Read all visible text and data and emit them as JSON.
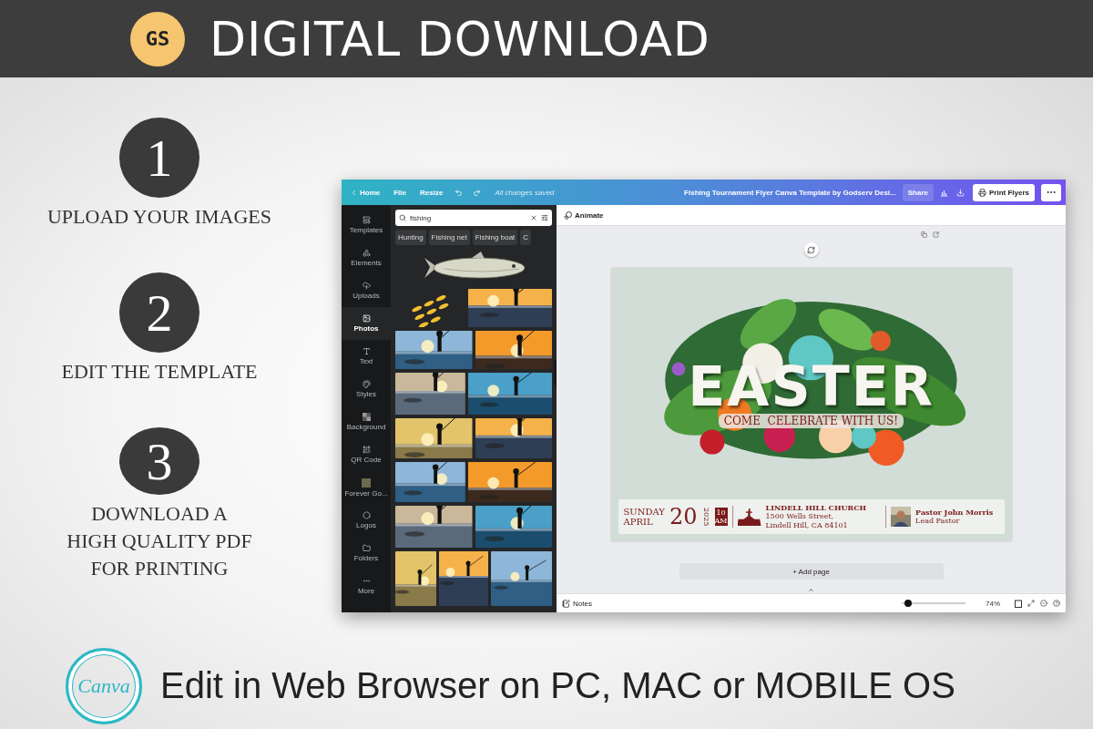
{
  "banner": {
    "logo": "GS",
    "title": "DIGITAL DOWNLOAD"
  },
  "steps": [
    {
      "number": "1",
      "lines": [
        "UPLOAD YOUR IMAGES"
      ]
    },
    {
      "number": "2",
      "lines": [
        "EDIT THE TEMPLATE"
      ]
    },
    {
      "number": "3",
      "lines": [
        "DOWNLOAD A",
        "HIGH QUALITY PDF",
        "FOR PRINTING"
      ]
    }
  ],
  "editor": {
    "topbar": {
      "home": "Home",
      "file": "File",
      "resize": "Resize",
      "status": "All changes saved",
      "title": "Fishing Tournament Flyer Canva Template by Godserv Desi...",
      "share": "Share",
      "print": "Print Flyers"
    },
    "rail": [
      {
        "label": "Templates",
        "selected": false
      },
      {
        "label": "Elements",
        "selected": false
      },
      {
        "label": "Uploads",
        "selected": false
      },
      {
        "label": "Photos",
        "selected": true
      },
      {
        "label": "Text",
        "selected": false
      },
      {
        "label": "Styles",
        "selected": false
      },
      {
        "label": "Background",
        "selected": false
      },
      {
        "label": "QR Code",
        "selected": false
      },
      {
        "label": "Forever Go...",
        "selected": false
      },
      {
        "label": "Logos",
        "selected": false
      },
      {
        "label": "Folders",
        "selected": false
      },
      {
        "label": "More",
        "selected": false
      }
    ],
    "search": {
      "value": "fishing"
    },
    "chips": [
      "Hunting",
      "Fishing net",
      "Fishing boat",
      "C"
    ],
    "animate": "Animate",
    "flyer": {
      "title": "EASTER",
      "subtitle": "COME  CELEBRATE WITH US!",
      "day": "SUNDAY",
      "month": "APRIL",
      "date": "20",
      "year": "2025",
      "time": "10 AM",
      "church": "LINDELL HILL CHURCH",
      "address": [
        "1500 Wells Street,",
        "Lindell Hill, CA 84101"
      ],
      "pastor": "Pastor John Morris",
      "role": "Lead Pastor"
    },
    "add_page": "+ Add page",
    "notes": "Notes",
    "zoom": {
      "level": 0.1,
      "reading": "74%"
    }
  },
  "footer": {
    "logo": "Canva",
    "text": "Edit in Web Browser on PC, MAC or MOBILE OS"
  }
}
